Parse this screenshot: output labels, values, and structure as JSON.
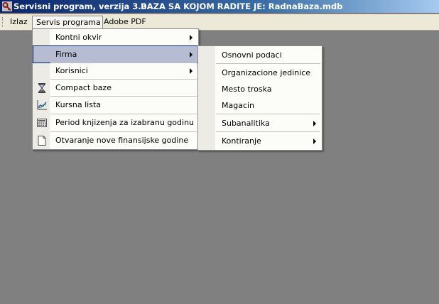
{
  "window": {
    "title": "Servisni program, verzija 3.0",
    "database_label": "BAZA SA KOJOM RADITE JE: RadnaBaza.mdb",
    "app_icon": "key-icon"
  },
  "menubar": {
    "items": [
      {
        "label": "Izlaz",
        "underline": "I"
      },
      {
        "label": "Servis programa",
        "underline": "S",
        "open": true
      },
      {
        "label": "Adobe PDF",
        "underline": "b"
      }
    ]
  },
  "servis_menu": {
    "items": [
      {
        "label": "Kontni okvir",
        "submenu": true,
        "icon": ""
      },
      {
        "label": "Firma",
        "submenu": true,
        "highlighted": true,
        "icon": ""
      },
      {
        "label": "Korisnici",
        "submenu": true,
        "icon": ""
      },
      {
        "label": "Compact baze",
        "submenu": false,
        "icon": "hourglass-icon"
      },
      {
        "label": "Kursna lista",
        "submenu": false,
        "icon": "line-chart-icon"
      },
      {
        "label": "Period knjizenja za izabranu godinu",
        "submenu": false,
        "icon": "calculator-icon"
      },
      {
        "label": "Otvaranje nove finansijske godine",
        "submenu": false,
        "icon": "new-document-icon"
      }
    ]
  },
  "firma_submenu": {
    "items": [
      {
        "label": "Osnovni podaci",
        "submenu": false
      },
      {
        "label": "Organizacione jedinice",
        "submenu": false
      },
      {
        "label": "Mesto troska",
        "submenu": false
      },
      {
        "label": "Magacin",
        "submenu": false
      },
      {
        "label": "Subanalitika",
        "submenu": true
      },
      {
        "label": "Kontiranje",
        "submenu": true
      }
    ]
  },
  "colors": {
    "title_bar_start": "#0a246a",
    "title_bar_end": "#a6caf0",
    "menu_bar": "#ece9d8",
    "workspace": "#808080",
    "highlight": "#b6bdd2",
    "highlight_border": "#0a246a"
  }
}
